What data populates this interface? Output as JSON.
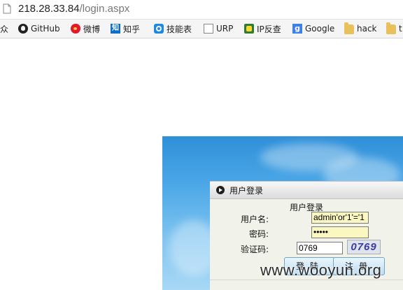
{
  "address_bar": {
    "host": "218.28.33.84",
    "path": "/login.aspx"
  },
  "bookmarks": [
    {
      "label": "众",
      "icon": "none"
    },
    {
      "label": "GitHub",
      "icon": "github-icon"
    },
    {
      "label": "微博",
      "icon": "weibo-icon"
    },
    {
      "label": "知乎",
      "icon": "zhihu-icon"
    },
    {
      "label": "技能表",
      "icon": "skill-icon"
    },
    {
      "label": "URP",
      "icon": "document-icon"
    },
    {
      "label": "IP反查",
      "icon": "ip-lookup-icon"
    },
    {
      "label": "Google",
      "icon": "google-icon"
    },
    {
      "label": "hack",
      "icon": "folder-icon"
    },
    {
      "label": "t",
      "icon": "folder-icon"
    }
  ],
  "login": {
    "header_title": "用户登录",
    "form_title": "用户登录",
    "username_label": "用户名:",
    "username_value": "admin'or'1'='1",
    "password_label": "密码:",
    "password_value": "•••••",
    "captcha_label": "验证码:",
    "captcha_input_value": "0769",
    "captcha_image_text": "0769",
    "login_button": "登陆",
    "register_button": "注册"
  },
  "watermark": "www.wooyun.org",
  "colors": {
    "input_highlight": "#fbf7c1",
    "panel_sky": "#4aa6e6"
  }
}
